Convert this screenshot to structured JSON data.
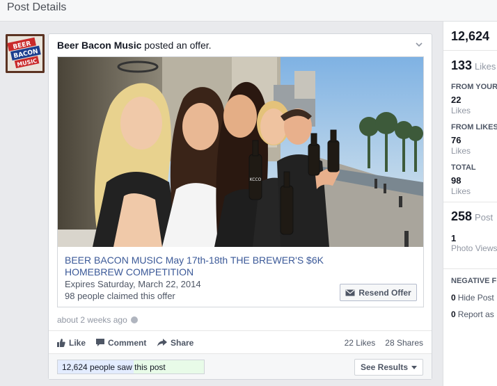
{
  "header": {
    "title": "Post Details"
  },
  "post": {
    "author": "Beer Bacon Music",
    "action": " posted an offer.",
    "avatar_text": [
      "BEER",
      "BACON",
      "MUSIC"
    ],
    "offer": {
      "title": "BEER BACON MUSIC May 17th-18th THE BREWER'S $6K HOMEBREW COMPETITION",
      "expires": "Expires Saturday, March 22, 2014",
      "claimed": "98 people claimed this offer",
      "resend_label": "Resend Offer",
      "bottle_label": "KCCO"
    },
    "timestamp": "about 2 weeks ago",
    "actions": {
      "like": "Like",
      "comment": "Comment",
      "share": "Share"
    },
    "counts": {
      "likes": "22 Likes",
      "shares": "28 Shares"
    },
    "reach": {
      "text": "12,624 people saw this post",
      "organic_fraction": 0.52,
      "total_fraction": 1.0
    },
    "see_results_label": "See Results"
  },
  "insights": {
    "reach_total": "12,624",
    "likes": {
      "value": "133",
      "label": "Likes"
    },
    "from_your": {
      "heading": "FROM YOUR",
      "value": "22",
      "label": "Likes"
    },
    "from_likes": {
      "heading": "FROM LIKES,",
      "value": "76",
      "label": "Likes"
    },
    "total": {
      "heading": "TOTAL",
      "value": "98",
      "label": "Likes"
    },
    "post_clicks": {
      "value": "258",
      "label": "Post"
    },
    "photo_views": {
      "value": "1",
      "label": "Photo Views"
    },
    "negative": {
      "heading": "NEGATIVE FE",
      "hide_post": {
        "value": "0",
        "label": "Hide Post"
      },
      "report": {
        "value": "0",
        "label": "Report as"
      }
    }
  },
  "colors": {
    "link": "#3b5998",
    "muted": "#9197a3",
    "background": "#e9eaed"
  }
}
